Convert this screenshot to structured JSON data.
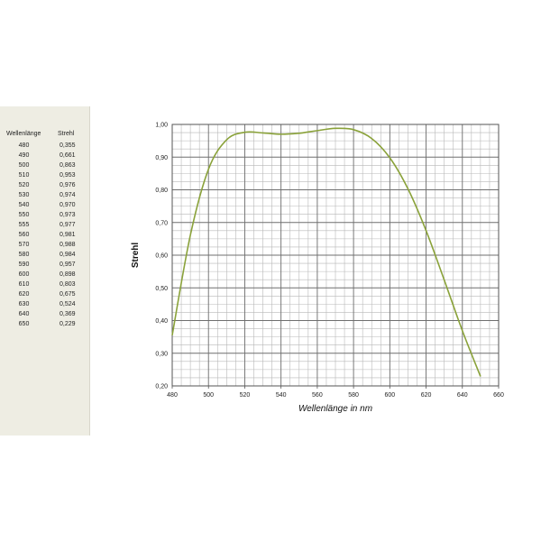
{
  "table": {
    "headers": {
      "wavelength": "Wellenlänge",
      "strehl": "Strehl"
    },
    "rows": [
      [
        "480",
        "0,355"
      ],
      [
        "490",
        "0,661"
      ],
      [
        "500",
        "0,863"
      ],
      [
        "510",
        "0,953"
      ],
      [
        "520",
        "0,976"
      ],
      [
        "530",
        "0,974"
      ],
      [
        "540",
        "0,970"
      ],
      [
        "550",
        "0,973"
      ],
      [
        "555",
        "0,977"
      ],
      [
        "560",
        "0,981"
      ],
      [
        "570",
        "0,988"
      ],
      [
        "580",
        "0,984"
      ],
      [
        "590",
        "0,957"
      ],
      [
        "600",
        "0,898"
      ],
      [
        "610",
        "0,803"
      ],
      [
        "620",
        "0,675"
      ],
      [
        "630",
        "0,524"
      ],
      [
        "640",
        "0,369"
      ],
      [
        "650",
        "0,229"
      ]
    ]
  },
  "chart_data": {
    "type": "line",
    "title": "",
    "xlabel": "Wellenlänge in nm",
    "ylabel": "Strehl",
    "xlim": [
      480,
      660
    ],
    "ylim": [
      0.2,
      1.0
    ],
    "x_ticks": [
      "480",
      "500",
      "520",
      "540",
      "560",
      "580",
      "600",
      "620",
      "640",
      "660"
    ],
    "y_ticks": [
      "0,20",
      "0,30",
      "0,40",
      "0,50",
      "0,60",
      "0,70",
      "0,80",
      "0,90",
      "1,00"
    ],
    "grid": true,
    "legend": "none",
    "line_color": "#8aa23a",
    "series": [
      {
        "x": [
          480,
          490,
          500,
          510,
          520,
          530,
          540,
          550,
          555,
          560,
          570,
          580,
          590,
          600,
          610,
          620,
          630,
          640,
          650
        ],
        "y": [
          0.355,
          0.661,
          0.863,
          0.953,
          0.976,
          0.974,
          0.97,
          0.973,
          0.977,
          0.981,
          0.988,
          0.984,
          0.957,
          0.898,
          0.803,
          0.675,
          0.524,
          0.369,
          0.229
        ]
      }
    ]
  }
}
